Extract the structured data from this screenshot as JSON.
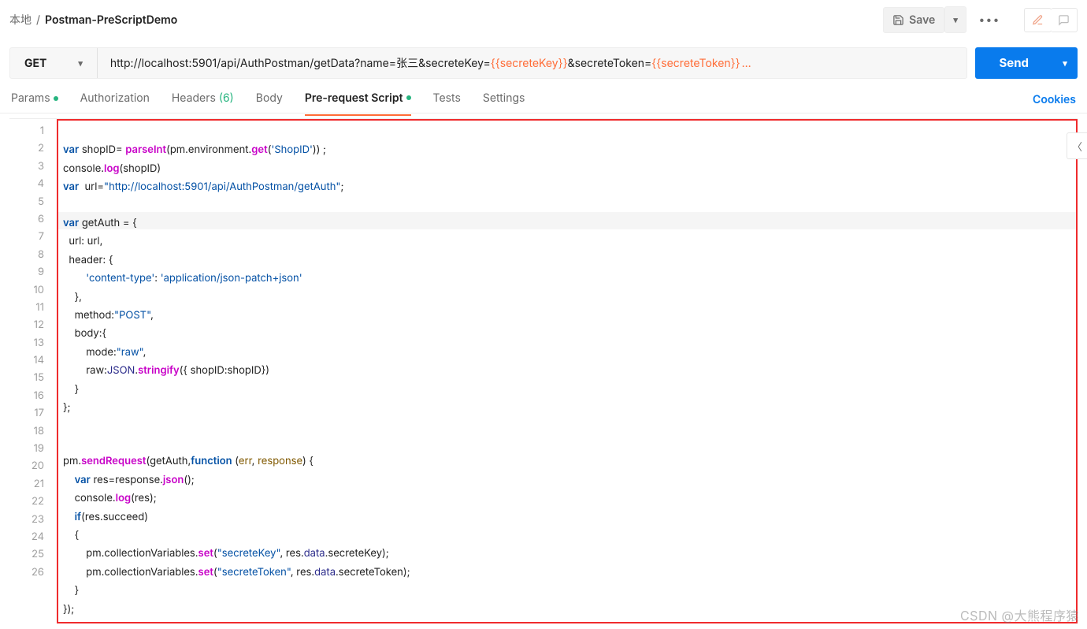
{
  "breadcrumb": {
    "root": "本地",
    "sep": "/",
    "name": "Postman-PreScriptDemo"
  },
  "toolbar": {
    "save": "Save"
  },
  "request": {
    "method": "GET",
    "url_pre": "http://localhost:5901/api/AuthPostman/getData?name=张三&secreteKey=",
    "var1": "{{secreteKey}}",
    "url_mid": "&secreteToken=",
    "var2": "{{secreteToken}}",
    "ellipsis": " ...",
    "send": "Send"
  },
  "tabs": {
    "params": "Params",
    "auth": "Authorization",
    "headers": "Headers",
    "headers_count": "(6)",
    "body": "Body",
    "pre": "Pre-request Script",
    "tests": "Tests",
    "settings": "Settings",
    "cookies": "Cookies"
  },
  "code": {
    "lines": 26,
    "l1a": "var",
    "l1b": " shopID= ",
    "l1c": "parseInt",
    "l1d": "(pm.environment.",
    "l1e": "get",
    "l1f": "(",
    "l1g": "'ShopID'",
    "l1h": ")) ;",
    "l2a": "console.",
    "l2b": "log",
    "l2c": "(shopID)",
    "l3a": "var",
    "l3b": "  url=",
    "l3c": "\"http://localhost:5901/api/AuthPostman/getAuth\"",
    "l3d": ";",
    "l5a": "var",
    "l5b": " getAuth = {",
    "l6": "  url: url,",
    "l7": "  header: {",
    "l8a": "        ",
    "l8b": "'content-type'",
    "l8c": ": ",
    "l8d": "'application/json-patch+json'",
    "l9": "    },",
    "l10a": "    method:",
    "l10b": "\"POST\"",
    "l10c": ",",
    "l11": "    body:{",
    "l12a": "        mode:",
    "l12b": "\"raw\"",
    "l12c": ",",
    "l13a": "        raw:",
    "l13b": "JSON",
    "l13c": ".",
    "l13d": "stringify",
    "l13e": "({ shopID:shopID})",
    "l14": "    }",
    "l15": "};",
    "l18a": "pm.",
    "l18b": "sendRequest",
    "l18c": "(getAuth,",
    "l18d": "function",
    "l18e": " (",
    "l18f": "err",
    "l18g": ", ",
    "l18h": "response",
    "l18i": ") {",
    "l19a": "    ",
    "l19b": "var",
    "l19c": " res=response.",
    "l19d": "json",
    "l19e": "();",
    "l20a": "    console.",
    "l20b": "log",
    "l20c": "(res);",
    "l21a": "    ",
    "l21b": "if",
    "l21c": "(res.succeed)",
    "l22": "    {",
    "l23a": "        pm.collectionVariables.",
    "l23b": "set",
    "l23c": "(",
    "l23d": "\"secreteKey\"",
    "l23e": ", res.",
    "l23f": "data",
    "l23g": ".secreteKey);",
    "l24a": "        pm.collectionVariables.",
    "l24b": "set",
    "l24c": "(",
    "l24d": "\"secreteToken\"",
    "l24e": ", res.",
    "l24f": "data",
    "l24g": ".secreteToken);",
    "l25": "    }",
    "l26": "});"
  },
  "watermark": "CSDN @大熊程序猿"
}
